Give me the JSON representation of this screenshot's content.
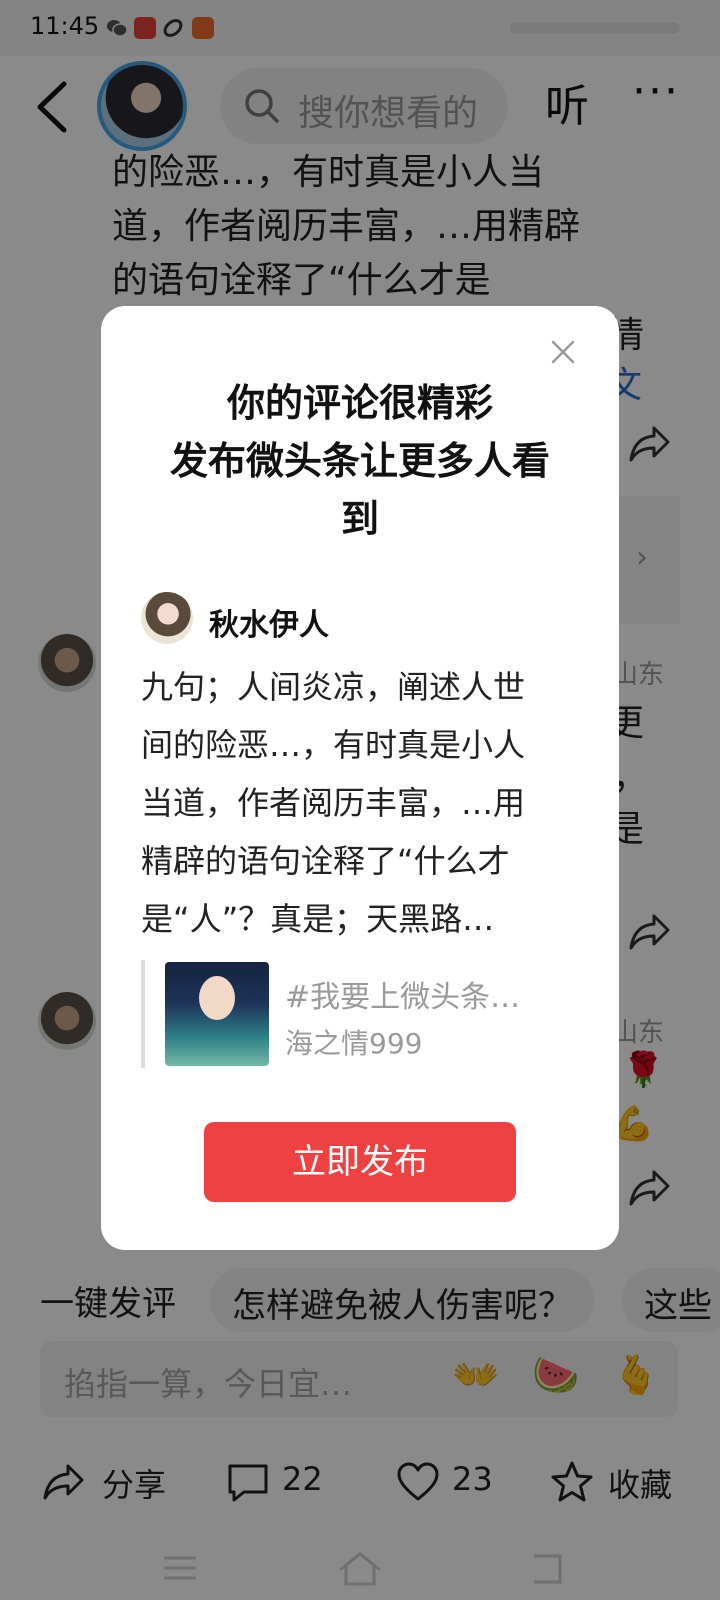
{
  "status_bar": {
    "time": "11:45"
  },
  "header": {
    "search_placeholder": "搜你想看的",
    "listen_label": "听",
    "more_label": "···"
  },
  "article": {
    "lines": [
      "的险恶…，有时真是小人当",
      "道，作者阅历丰富，…用精辟",
      "的语句诠释了“什么才是"
    ],
    "peek_right": [
      "情",
      "文"
    ],
    "peek_location": [
      "山东",
      "山东"
    ],
    "peek_comment": [
      "更",
      "，",
      "是"
    ]
  },
  "quick_replies": {
    "label": "一键发评",
    "chips": [
      "怎样避免被人伤害呢？",
      "这些"
    ]
  },
  "comment_input": {
    "placeholder": "掐指一算，今日宜…",
    "emojis": [
      "👐",
      "🍉",
      "🫰"
    ]
  },
  "actions": {
    "share_label": "分享",
    "comment_count": "22",
    "like_count": "23",
    "favorite_label": "收藏"
  },
  "dialog": {
    "title_lines": [
      "你的评论很精彩",
      "发布微头条让更多人看",
      "到"
    ],
    "user_name": "秋水伊人",
    "body_lines": [
      "九句；人间炎凉，阐述人世",
      "间的险恶…，有时真是小人",
      "当道，作者阅历丰富，…用",
      "精辟的语句诠释了“什么才",
      "是“人”？真是；天黑路…"
    ],
    "quote_title": "#我要上微头条…",
    "quote_user": "海之情999",
    "publish_label": "立即发布"
  }
}
